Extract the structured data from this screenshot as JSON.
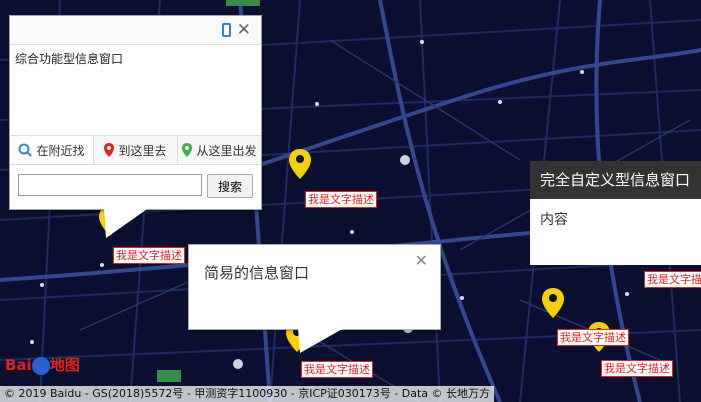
{
  "complex_window": {
    "title": "综合功能型信息窗口",
    "tabs": [
      "在附近找",
      "到这里去",
      "从这里出发"
    ],
    "search_button": "搜索",
    "search_value": ""
  },
  "simple_window": {
    "title": "简易的信息窗口"
  },
  "custom_window": {
    "title": "完全自定义型信息窗口",
    "content": "内容"
  },
  "marker_labels": [
    "我是文字描述",
    "我是文字描述",
    "我是文字描述",
    "我是文字描述",
    "我是文字描述",
    "我是文字描述"
  ],
  "copyright": "© 2019 Baidu - GS(2018)5572号 - 甲测资字1100930 - 京ICP证030173号 - Data © 长地万方",
  "logo_text": "Bai",
  "logo_text2": "地图",
  "colors": {
    "map_bg": "#0b1030",
    "road": "#2a3a78",
    "pin": "#f5d000",
    "label_red": "#e2231a"
  }
}
